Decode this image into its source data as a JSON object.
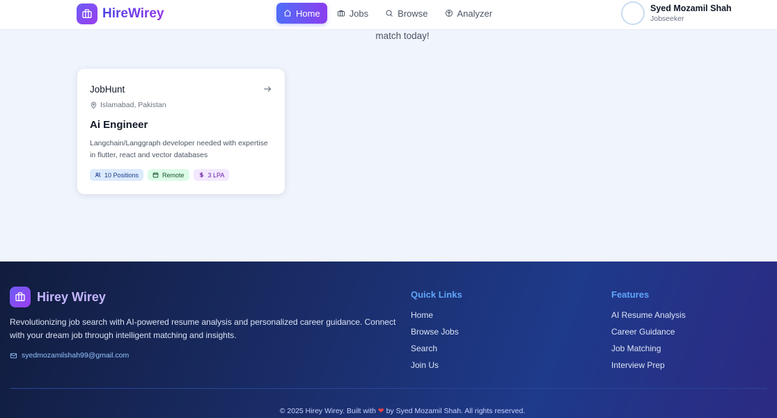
{
  "header": {
    "brand": "HireWirey",
    "nav": [
      {
        "label": "Home",
        "icon": "home-icon"
      },
      {
        "label": "Jobs",
        "icon": "briefcase-icon"
      },
      {
        "label": "Browse",
        "icon": "search-icon"
      },
      {
        "label": "Analyzer",
        "icon": "brain-icon"
      }
    ],
    "user": {
      "name": "Syed Mozamil Shah",
      "role": "Jobseeker"
    }
  },
  "hero": {
    "tagline": "match today!"
  },
  "job": {
    "company": "JobHunt",
    "location": "Islamabad, Pakistan",
    "title": "Ai Engineer",
    "description": "Langchain/Langgraph developer needed with expertise in flutter, react and vector databases",
    "badges": {
      "positions": "10 Positions",
      "type": "Remote",
      "salary": "3 LPA"
    }
  },
  "footer": {
    "brand": "Hirey Wirey",
    "description": "Revolutionizing job search with AI-powered resume analysis and personalized career guidance. Connect with your dream job through intelligent matching and insights.",
    "email": "syedmozamilshah99@gmail.com",
    "quick_links": {
      "title": "Quick Links",
      "items": [
        "Home",
        "Browse Jobs",
        "Search",
        "Join Us"
      ]
    },
    "features": {
      "title": "Features",
      "items": [
        "AI Resume Analysis",
        "Career Guidance",
        "Job Matching",
        "Interview Prep"
      ]
    },
    "copyright_pre": "© 2025 Hirey Wirey. Built with",
    "copyright_post": "by Syed Mozamil Shah. All rights reserved."
  },
  "colors": {
    "accent": "#6366f1",
    "footer_bg": "#1e3a8a",
    "heading": "#60a5fa"
  }
}
